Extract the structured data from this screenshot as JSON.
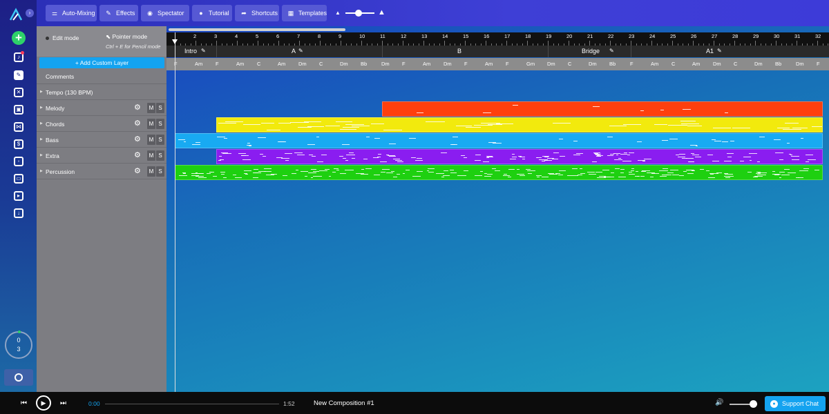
{
  "toolbar": {
    "buttons": [
      {
        "icon": "sliders-icon",
        "glyph": "⚌",
        "label": "Auto-Mixing"
      },
      {
        "icon": "wand-icon",
        "glyph": "✎",
        "label": "Effects"
      },
      {
        "icon": "eye-icon",
        "glyph": "◉",
        "label": "Spectator"
      },
      {
        "icon": "book-icon",
        "glyph": "●",
        "label": "Tutorial"
      },
      {
        "icon": "share-arrow-icon",
        "glyph": "➦",
        "label": "Shortcuts"
      },
      {
        "icon": "grid-icon",
        "glyph": "▦",
        "label": "Templates"
      }
    ],
    "zoom_level": 0.45
  },
  "rail": {
    "counter_top": "0",
    "counter_bottom": "3"
  },
  "panel": {
    "edit_mode": "Edit mode",
    "pointer_mode": "Pointer mode",
    "pencil_hint": "Ctrl + E for Pencil mode",
    "add_layer": "+ Add Custom Layer",
    "rows": [
      {
        "label": "Comments",
        "controls": false
      },
      {
        "label": "Tempo (130 BPM)",
        "controls": false
      },
      {
        "label": "Melody",
        "controls": true
      },
      {
        "label": "Chords",
        "controls": true
      },
      {
        "label": "Bass",
        "controls": true
      },
      {
        "label": "Extra",
        "controls": true
      },
      {
        "label": "Percussion",
        "controls": true
      }
    ],
    "mute_label": "M",
    "solo_label": "S"
  },
  "timeline": {
    "bars": [
      "2",
      "3",
      "4",
      "5",
      "6",
      "7",
      "8",
      "9",
      "10",
      "11",
      "12",
      "13",
      "14",
      "15",
      "16",
      "17",
      "18",
      "19",
      "20",
      "21",
      "22",
      "23",
      "24",
      "25",
      "26",
      "27",
      "28",
      "29",
      "30",
      "31",
      "32"
    ],
    "sections": [
      {
        "name": "Intro",
        "start": 1,
        "end": 3
      },
      {
        "name": "A",
        "start": 3,
        "end": 11
      },
      {
        "name": "B",
        "start": 11,
        "end": 19
      },
      {
        "name": "Bridge",
        "start": 19,
        "end": 23
      },
      {
        "name": "A1",
        "start": 23,
        "end": 31
      }
    ],
    "chords": [
      "F",
      "Am",
      "F",
      "Am",
      "C",
      "Am",
      "Dm",
      "C",
      "Dm",
      "Bb",
      "Dm",
      "F",
      "Am",
      "Dm",
      "F",
      "Am",
      "F",
      "Gm",
      "Dm",
      "C",
      "Dm",
      "Bb",
      "F",
      "Am",
      "C",
      "Am",
      "Dm",
      "C",
      "Dm",
      "Bb",
      "Dm",
      "F"
    ],
    "layers": [
      {
        "name": "Melody",
        "color": "#ff3f0d",
        "start": 11,
        "end": 32.2
      },
      {
        "name": "Chords",
        "color": "#f2ea0d",
        "start": 3,
        "end": 32.2
      },
      {
        "name": "Bass",
        "color": "#18aaf2",
        "start": 1,
        "end": 32.2
      },
      {
        "name": "Extra",
        "color": "#8a1df0",
        "start": 3,
        "end": 32.2
      },
      {
        "name": "Percussion",
        "color": "#1ed010",
        "start": 1,
        "end": 32.2
      }
    ]
  },
  "player": {
    "current_time": "0:00",
    "duration": "1:52",
    "title": "New Composition #1",
    "volume": 0.85,
    "support_label": "Support Chat"
  }
}
